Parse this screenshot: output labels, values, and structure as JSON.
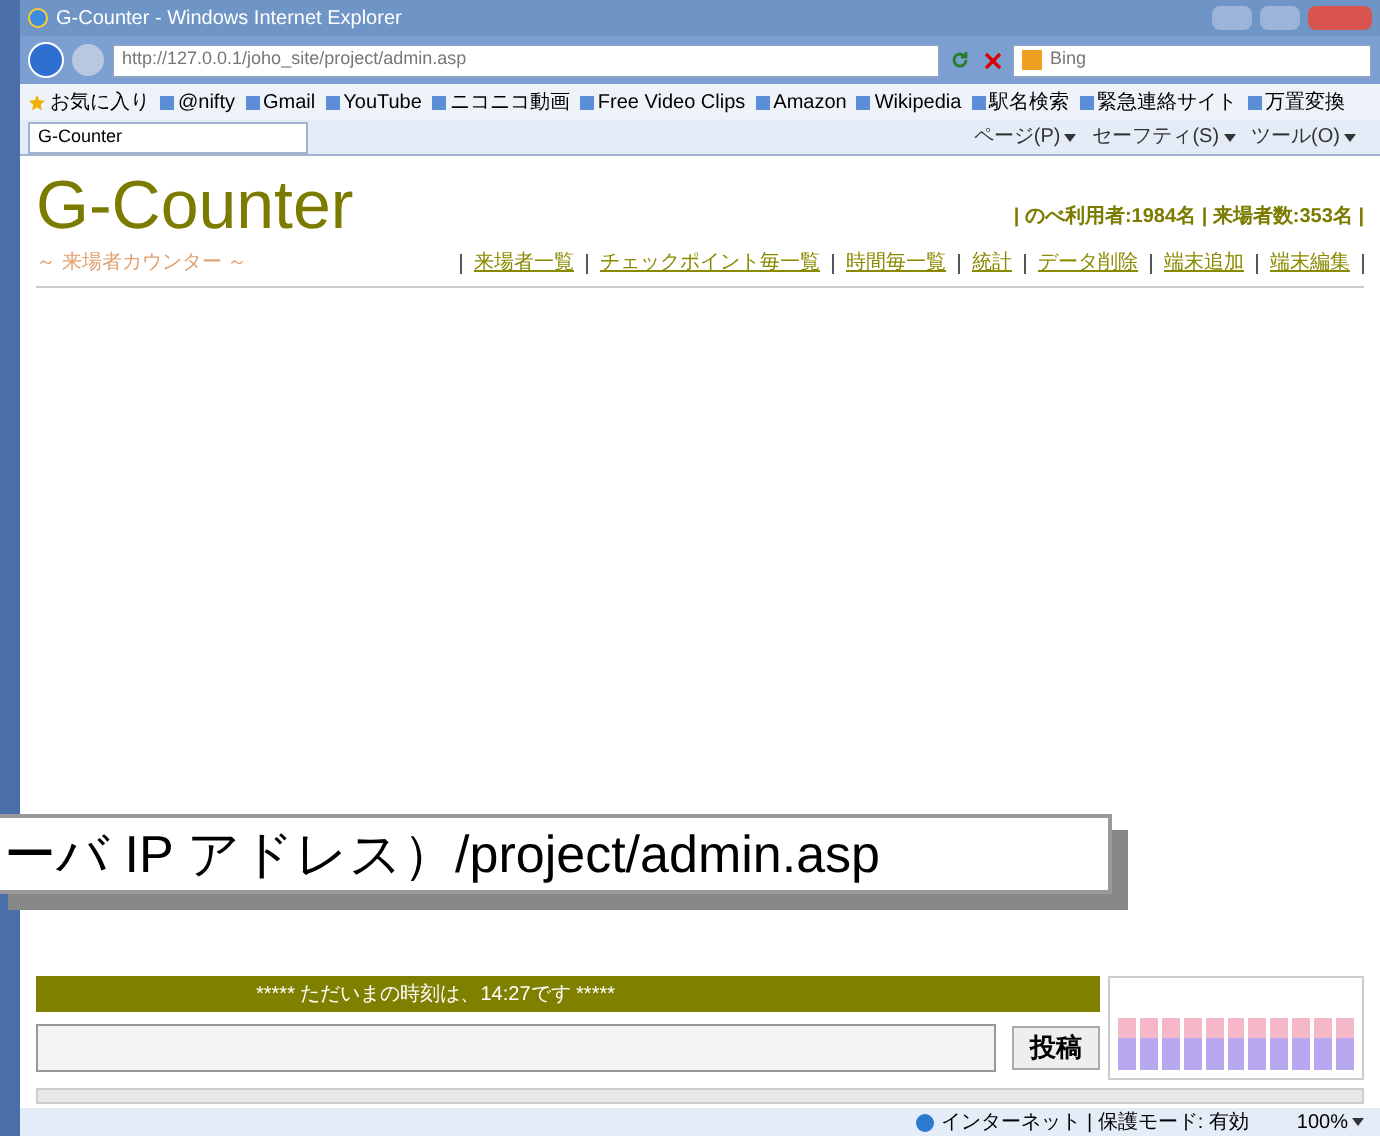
{
  "window": {
    "title": "G-Counter - Windows Internet Explorer"
  },
  "address_bar": {
    "url": "http://127.0.0.1/joho_site/project/admin.asp"
  },
  "search": {
    "placeholder": "Bing"
  },
  "favorites_bar": {
    "label": "お気に入り",
    "items": [
      "@nifty",
      "Gmail",
      "YouTube",
      "ニコニコ動画",
      "Free Video Clips",
      "Amazon",
      "Wikipedia",
      "駅名検索",
      "緊急連絡サイト",
      "万置変換"
    ]
  },
  "tab": {
    "title": "G-Counter"
  },
  "command_bar": [
    "ページ(P)",
    "セーフティ(S)",
    "ツール(O)"
  ],
  "page": {
    "logo": "G-Counter",
    "subtitle": "～ 来場者カウンター ～",
    "stats": "| のべ利用者:1984名 | 来場者数:353名 |",
    "nav": [
      "来場者一覧",
      "チェックポイント毎一覧",
      "時間毎一覧",
      "統計",
      "データ削除",
      "端末追加",
      "端末編集"
    ],
    "clock_banner": "***** ただいまの時刻は、14:27です *****",
    "post_button": "投稿"
  },
  "callout": "ーバ IP アドレス）/project/admin.asp",
  "status_bar": {
    "zone": "インターネット | 保護モード: 有効",
    "zoom": "100%"
  }
}
